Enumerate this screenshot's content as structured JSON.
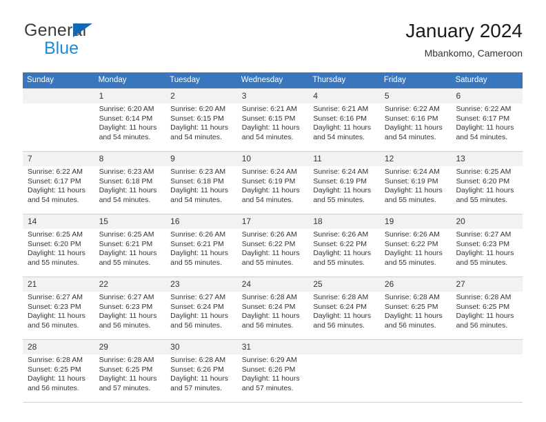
{
  "brand": {
    "name_part1": "General",
    "name_part2": "Blue",
    "triangle_color": "#1268b3",
    "blue_color": "#1e8ad6"
  },
  "header": {
    "title": "January 2024",
    "location": "Mbankomo, Cameroon"
  },
  "theme": {
    "header_row_bg": "#3a76bd",
    "day_number_bg": "#f2f2f2",
    "grid_line": "#d0d0d0",
    "text": "#333333"
  },
  "weekdays": [
    "Sunday",
    "Monday",
    "Tuesday",
    "Wednesday",
    "Thursday",
    "Friday",
    "Saturday"
  ],
  "weeks": [
    {
      "days": [
        {
          "num": "",
          "sunrise": "",
          "sunset": "",
          "daylight1": "",
          "daylight2": ""
        },
        {
          "num": "1",
          "sunrise": "Sunrise: 6:20 AM",
          "sunset": "Sunset: 6:14 PM",
          "daylight1": "Daylight: 11 hours",
          "daylight2": "and 54 minutes."
        },
        {
          "num": "2",
          "sunrise": "Sunrise: 6:20 AM",
          "sunset": "Sunset: 6:15 PM",
          "daylight1": "Daylight: 11 hours",
          "daylight2": "and 54 minutes."
        },
        {
          "num": "3",
          "sunrise": "Sunrise: 6:21 AM",
          "sunset": "Sunset: 6:15 PM",
          "daylight1": "Daylight: 11 hours",
          "daylight2": "and 54 minutes."
        },
        {
          "num": "4",
          "sunrise": "Sunrise: 6:21 AM",
          "sunset": "Sunset: 6:16 PM",
          "daylight1": "Daylight: 11 hours",
          "daylight2": "and 54 minutes."
        },
        {
          "num": "5",
          "sunrise": "Sunrise: 6:22 AM",
          "sunset": "Sunset: 6:16 PM",
          "daylight1": "Daylight: 11 hours",
          "daylight2": "and 54 minutes."
        },
        {
          "num": "6",
          "sunrise": "Sunrise: 6:22 AM",
          "sunset": "Sunset: 6:17 PM",
          "daylight1": "Daylight: 11 hours",
          "daylight2": "and 54 minutes."
        }
      ]
    },
    {
      "days": [
        {
          "num": "7",
          "sunrise": "Sunrise: 6:22 AM",
          "sunset": "Sunset: 6:17 PM",
          "daylight1": "Daylight: 11 hours",
          "daylight2": "and 54 minutes."
        },
        {
          "num": "8",
          "sunrise": "Sunrise: 6:23 AM",
          "sunset": "Sunset: 6:18 PM",
          "daylight1": "Daylight: 11 hours",
          "daylight2": "and 54 minutes."
        },
        {
          "num": "9",
          "sunrise": "Sunrise: 6:23 AM",
          "sunset": "Sunset: 6:18 PM",
          "daylight1": "Daylight: 11 hours",
          "daylight2": "and 54 minutes."
        },
        {
          "num": "10",
          "sunrise": "Sunrise: 6:24 AM",
          "sunset": "Sunset: 6:19 PM",
          "daylight1": "Daylight: 11 hours",
          "daylight2": "and 54 minutes."
        },
        {
          "num": "11",
          "sunrise": "Sunrise: 6:24 AM",
          "sunset": "Sunset: 6:19 PM",
          "daylight1": "Daylight: 11 hours",
          "daylight2": "and 55 minutes."
        },
        {
          "num": "12",
          "sunrise": "Sunrise: 6:24 AM",
          "sunset": "Sunset: 6:19 PM",
          "daylight1": "Daylight: 11 hours",
          "daylight2": "and 55 minutes."
        },
        {
          "num": "13",
          "sunrise": "Sunrise: 6:25 AM",
          "sunset": "Sunset: 6:20 PM",
          "daylight1": "Daylight: 11 hours",
          "daylight2": "and 55 minutes."
        }
      ]
    },
    {
      "days": [
        {
          "num": "14",
          "sunrise": "Sunrise: 6:25 AM",
          "sunset": "Sunset: 6:20 PM",
          "daylight1": "Daylight: 11 hours",
          "daylight2": "and 55 minutes."
        },
        {
          "num": "15",
          "sunrise": "Sunrise: 6:25 AM",
          "sunset": "Sunset: 6:21 PM",
          "daylight1": "Daylight: 11 hours",
          "daylight2": "and 55 minutes."
        },
        {
          "num": "16",
          "sunrise": "Sunrise: 6:26 AM",
          "sunset": "Sunset: 6:21 PM",
          "daylight1": "Daylight: 11 hours",
          "daylight2": "and 55 minutes."
        },
        {
          "num": "17",
          "sunrise": "Sunrise: 6:26 AM",
          "sunset": "Sunset: 6:22 PM",
          "daylight1": "Daylight: 11 hours",
          "daylight2": "and 55 minutes."
        },
        {
          "num": "18",
          "sunrise": "Sunrise: 6:26 AM",
          "sunset": "Sunset: 6:22 PM",
          "daylight1": "Daylight: 11 hours",
          "daylight2": "and 55 minutes."
        },
        {
          "num": "19",
          "sunrise": "Sunrise: 6:26 AM",
          "sunset": "Sunset: 6:22 PM",
          "daylight1": "Daylight: 11 hours",
          "daylight2": "and 55 minutes."
        },
        {
          "num": "20",
          "sunrise": "Sunrise: 6:27 AM",
          "sunset": "Sunset: 6:23 PM",
          "daylight1": "Daylight: 11 hours",
          "daylight2": "and 55 minutes."
        }
      ]
    },
    {
      "days": [
        {
          "num": "21",
          "sunrise": "Sunrise: 6:27 AM",
          "sunset": "Sunset: 6:23 PM",
          "daylight1": "Daylight: 11 hours",
          "daylight2": "and 56 minutes."
        },
        {
          "num": "22",
          "sunrise": "Sunrise: 6:27 AM",
          "sunset": "Sunset: 6:23 PM",
          "daylight1": "Daylight: 11 hours",
          "daylight2": "and 56 minutes."
        },
        {
          "num": "23",
          "sunrise": "Sunrise: 6:27 AM",
          "sunset": "Sunset: 6:24 PM",
          "daylight1": "Daylight: 11 hours",
          "daylight2": "and 56 minutes."
        },
        {
          "num": "24",
          "sunrise": "Sunrise: 6:28 AM",
          "sunset": "Sunset: 6:24 PM",
          "daylight1": "Daylight: 11 hours",
          "daylight2": "and 56 minutes."
        },
        {
          "num": "25",
          "sunrise": "Sunrise: 6:28 AM",
          "sunset": "Sunset: 6:24 PM",
          "daylight1": "Daylight: 11 hours",
          "daylight2": "and 56 minutes."
        },
        {
          "num": "26",
          "sunrise": "Sunrise: 6:28 AM",
          "sunset": "Sunset: 6:25 PM",
          "daylight1": "Daylight: 11 hours",
          "daylight2": "and 56 minutes."
        },
        {
          "num": "27",
          "sunrise": "Sunrise: 6:28 AM",
          "sunset": "Sunset: 6:25 PM",
          "daylight1": "Daylight: 11 hours",
          "daylight2": "and 56 minutes."
        }
      ]
    },
    {
      "days": [
        {
          "num": "28",
          "sunrise": "Sunrise: 6:28 AM",
          "sunset": "Sunset: 6:25 PM",
          "daylight1": "Daylight: 11 hours",
          "daylight2": "and 56 minutes."
        },
        {
          "num": "29",
          "sunrise": "Sunrise: 6:28 AM",
          "sunset": "Sunset: 6:25 PM",
          "daylight1": "Daylight: 11 hours",
          "daylight2": "and 57 minutes."
        },
        {
          "num": "30",
          "sunrise": "Sunrise: 6:28 AM",
          "sunset": "Sunset: 6:26 PM",
          "daylight1": "Daylight: 11 hours",
          "daylight2": "and 57 minutes."
        },
        {
          "num": "31",
          "sunrise": "Sunrise: 6:29 AM",
          "sunset": "Sunset: 6:26 PM",
          "daylight1": "Daylight: 11 hours",
          "daylight2": "and 57 minutes."
        },
        {
          "num": "",
          "sunrise": "",
          "sunset": "",
          "daylight1": "",
          "daylight2": ""
        },
        {
          "num": "",
          "sunrise": "",
          "sunset": "",
          "daylight1": "",
          "daylight2": ""
        },
        {
          "num": "",
          "sunrise": "",
          "sunset": "",
          "daylight1": "",
          "daylight2": ""
        }
      ]
    }
  ]
}
